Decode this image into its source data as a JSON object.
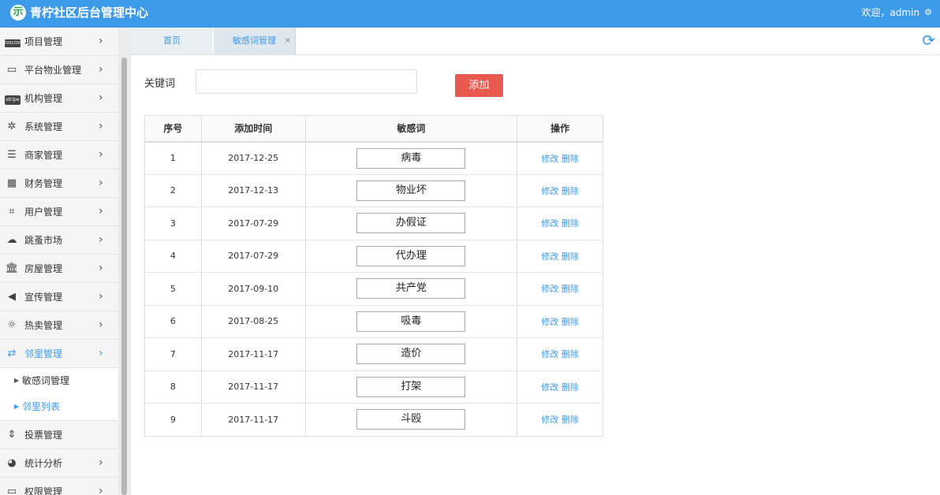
{
  "header": {
    "logo_glyph": "示",
    "title": "青柠社区后台管理中心",
    "welcome": "欢迎，admin",
    "settings_icon": "gear-icon"
  },
  "sidebar": {
    "items": [
      {
        "label": "项目管理",
        "icon": "discover-card-icon"
      },
      {
        "label": "平台物业管理",
        "icon": "monitor-icon"
      },
      {
        "label": "机构管理",
        "icon": "stripe-icon"
      },
      {
        "label": "系统管理",
        "icon": "yelp-icon"
      },
      {
        "label": "商家管理",
        "icon": "bars-icon"
      },
      {
        "label": "财务管理",
        "icon": "calculator-icon"
      },
      {
        "label": "用户管理",
        "icon": "crop-icon"
      },
      {
        "label": "跳蚤市场",
        "icon": "cloud-icon"
      },
      {
        "label": "房屋管理",
        "icon": "bank-icon"
      },
      {
        "label": "宣传管理",
        "icon": "volume-icon"
      },
      {
        "label": "热卖管理",
        "icon": "sun-icon"
      },
      {
        "label": "邻里管理",
        "icon": "retweet-icon"
      },
      {
        "label": "投票管理",
        "icon": "sort-icon"
      },
      {
        "label": "统计分析",
        "icon": "pie-chart-icon"
      },
      {
        "label": "权限管理",
        "icon": "desktop-icon"
      }
    ],
    "sub_items": [
      {
        "label": "敏感词管理"
      },
      {
        "label": "邻里列表"
      }
    ],
    "discover_text": "DISCOVER",
    "stripe_text": "stripe"
  },
  "tabs": {
    "home": "首页",
    "active": "敏感词管理",
    "close_glyph": "×"
  },
  "form": {
    "keyword_label": "关键词",
    "keyword_value": "",
    "keyword_placeholder": "",
    "add_label": "添加"
  },
  "table": {
    "headers": [
      "序号",
      "添加时间",
      "敏感词",
      "操作"
    ],
    "rows": [
      {
        "no": "1",
        "date": "2017-12-25",
        "word": "病毒"
      },
      {
        "no": "2",
        "date": "2017-12-13",
        "word": "物业坏"
      },
      {
        "no": "3",
        "date": "2017-07-29",
        "word": "办假证"
      },
      {
        "no": "4",
        "date": "2017-07-29",
        "word": "代办理"
      },
      {
        "no": "5",
        "date": "2017-09-10",
        "word": "共产党"
      },
      {
        "no": "6",
        "date": "2017-08-25",
        "word": "吸毒"
      },
      {
        "no": "7",
        "date": "2017-11-17",
        "word": "造价"
      },
      {
        "no": "8",
        "date": "2017-11-17",
        "word": "打架"
      },
      {
        "no": "9",
        "date": "2017-11-17",
        "word": "斗殴"
      }
    ],
    "edit_label": "修改",
    "delete_label": "删除"
  },
  "colors": {
    "brand": "#3d9ae8",
    "add_button": "#e85a4f",
    "logo_green": "#2ea556"
  }
}
